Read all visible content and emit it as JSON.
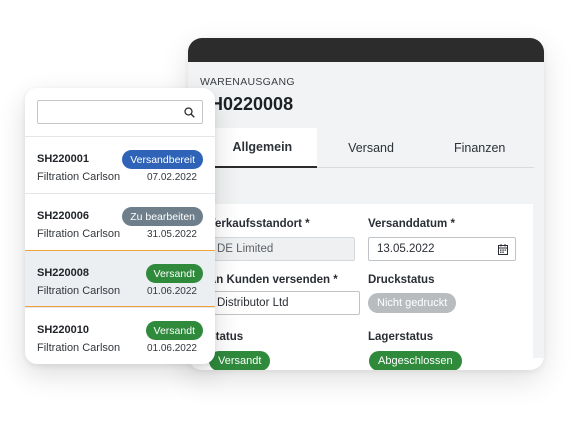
{
  "detail": {
    "doc_type": "WARENAUSGANG",
    "doc_number": "H0220008",
    "tabs": [
      {
        "label": "Allgemein",
        "active": true
      },
      {
        "label": "Versand",
        "active": false
      },
      {
        "label": "Finanzen",
        "active": false
      }
    ],
    "fields": {
      "sales_location": {
        "label": "Verkaufsstandort *",
        "value": "DE Limited"
      },
      "ship_date": {
        "label": "Versanddatum *",
        "value": "13.05.2022"
      },
      "ship_to_customer": {
        "label": "An Kunden versenden *",
        "value": "Distributor Ltd"
      },
      "print_status": {
        "label": "Druckstatus",
        "value": "Nicht gedruckt"
      },
      "status": {
        "label": "Status",
        "value": "Versandt"
      },
      "stock_status": {
        "label": "Lagerstatus",
        "value": "Abgeschlossen"
      }
    }
  },
  "list": {
    "search": {
      "value": "",
      "placeholder": ""
    },
    "items": [
      {
        "id": "SH220001",
        "customer": "Filtration Carlson",
        "date": "07.02.2022",
        "status": "Versandbereit",
        "status_color": "#2f63b8",
        "selected": false
      },
      {
        "id": "SH220006",
        "customer": "Filtration Carlson",
        "date": "31.05.2022",
        "status": "Zu bearbeiten",
        "status_color": "#6e7f8b",
        "selected": false
      },
      {
        "id": "SH220008",
        "customer": "Filtration Carlson",
        "date": "01.06.2022",
        "status": "Versandt",
        "status_color": "#2f8a3c",
        "selected": true
      },
      {
        "id": "SH220010",
        "customer": "Filtration Carlson",
        "date": "01.06.2022",
        "status": "Versandt",
        "status_color": "#2f8a3c",
        "selected": false
      }
    ]
  },
  "colors": {
    "titlebar": "#2c2c2c",
    "selected_accent": "#f0a33c",
    "green": "#2f8a3c",
    "blue": "#2f63b8",
    "slate": "#6e7f8b",
    "gray": "#b8bcbf"
  }
}
